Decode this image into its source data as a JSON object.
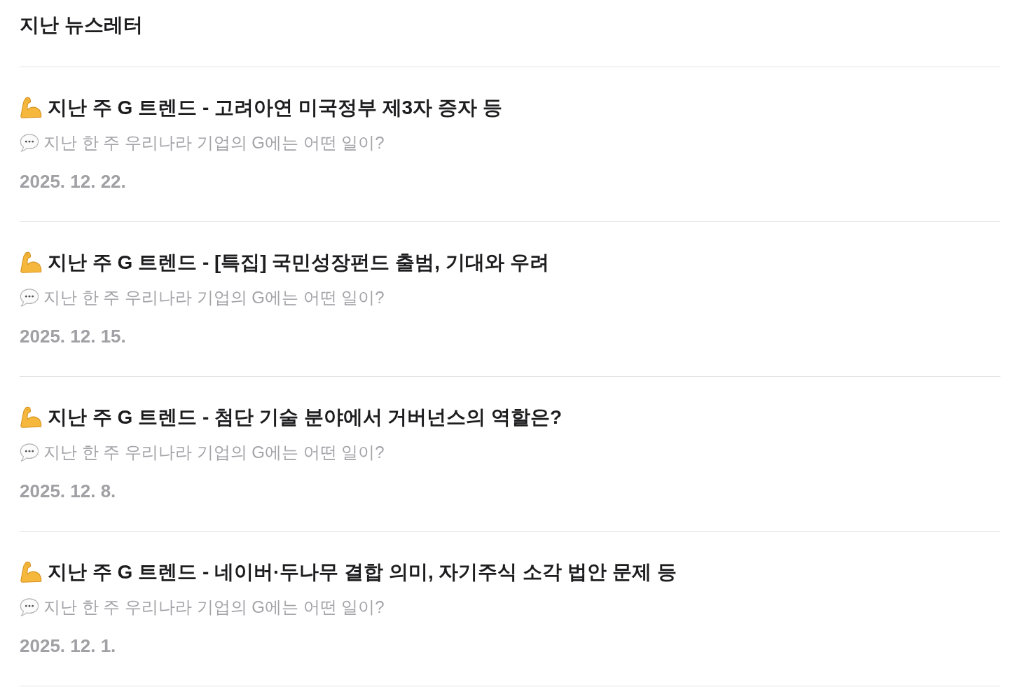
{
  "heading": "지난 뉴스레터",
  "newsletters": [
    {
      "title": "지난 주 G 트렌드 - 고려아연 미국정부 제3자 증자 등",
      "summary": "지난 한 주 우리나라 기업의 G에는 어떤 일이?",
      "date": "2025. 12. 22."
    },
    {
      "title": "지난 주 G 트렌드 - [특집] 국민성장펀드 출범, 기대와 우려",
      "summary": "지난 한 주 우리나라 기업의 G에는 어떤 일이?",
      "date": "2025. 12. 15."
    },
    {
      "title": "지난 주 G 트렌드 - 첨단 기술 분야에서 거버넌스의 역할은?",
      "summary": "지난 한 주 우리나라 기업의 G에는 어떤 일이?",
      "date": "2025. 12. 8."
    },
    {
      "title": "지난 주 G 트렌드 - 네이버·두나무 결합 의미, 자기주식 소각 법안 문제 등",
      "summary": "지난 한 주 우리나라 기업의 G에는 어떤 일이?",
      "date": "2025. 12. 1."
    }
  ]
}
